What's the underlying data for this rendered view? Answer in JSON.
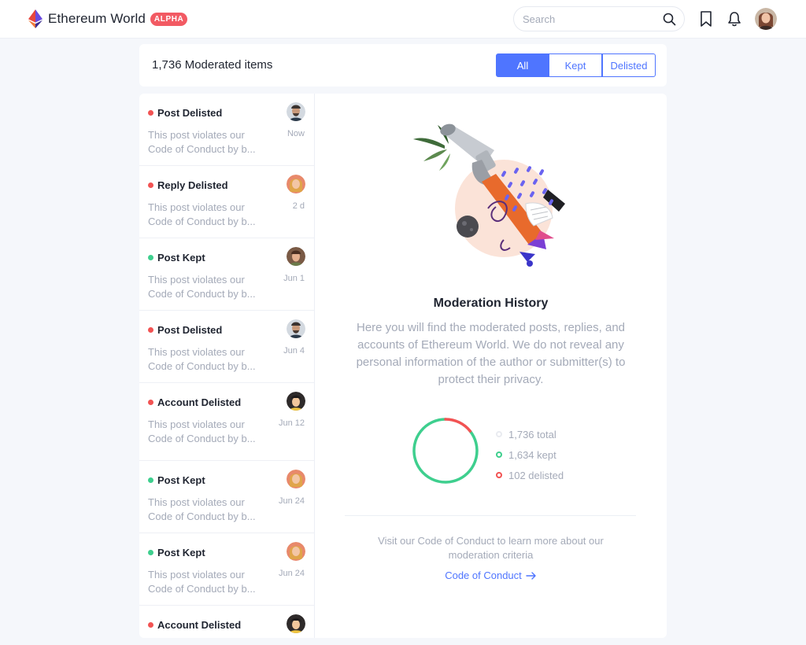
{
  "app": {
    "name": "Ethereum World",
    "badge": "ALPHA"
  },
  "search": {
    "placeholder": "Search"
  },
  "icons": {
    "brand": "ethereum-logo-icon",
    "search": "search-icon",
    "bookmark": "bookmark-icon",
    "notifications": "bell-icon"
  },
  "colors": {
    "accent": "#4f75ff",
    "kept": "#3ecf8e",
    "delisted": "#f25353",
    "badge": "#f25a63"
  },
  "header": {
    "title": "1,736 Moderated items"
  },
  "filters": [
    {
      "label": "All",
      "active": true
    },
    {
      "label": "Kept",
      "active": false
    },
    {
      "label": "Delisted",
      "active": false
    }
  ],
  "items": [
    {
      "status": "delisted",
      "title": "Post Delisted",
      "date": "Now",
      "text": "This post violates our Code of Conduct by b..."
    },
    {
      "status": "delisted",
      "title": "Reply Delisted",
      "date": "2 d",
      "text": "This post violates our Code of Conduct by b..."
    },
    {
      "status": "kept",
      "title": "Post Kept",
      "date": "Jun 1",
      "text": "This post violates our Code of Conduct by b..."
    },
    {
      "status": "delisted",
      "title": "Post Delisted",
      "date": "Jun 4",
      "text": "This post violates our Code of Conduct by b..."
    },
    {
      "status": "delisted",
      "title": "Account Delisted",
      "date": "Jun 12",
      "text": "This post violates our Code of Conduct by b..."
    },
    {
      "status": "kept",
      "title": "Post Kept",
      "date": "Jun 24",
      "text": "This post violates our Code of Conduct by b..."
    },
    {
      "status": "kept",
      "title": "Post Kept",
      "date": "Jun 24",
      "text": "This post violates our Code of Conduct by b..."
    },
    {
      "status": "delisted",
      "title": "Account Delisted",
      "date": "",
      "text": ""
    }
  ],
  "detail": {
    "title": "Moderation History",
    "description": "Here you will find the moderated posts, replies, and accounts of Ethereum World. We do not reveal any personal information of the author or submitter(s) to protect their privacy.",
    "stats": {
      "total": 1736,
      "kept": 1634,
      "delisted": 102
    },
    "legend": {
      "total": "1,736 total",
      "kept": "1,634 kept",
      "delisted": "102 delisted"
    },
    "visit_text": "Visit our Code of Conduct to learn more about our moderation criteria",
    "link_label": "Code of Conduct"
  }
}
